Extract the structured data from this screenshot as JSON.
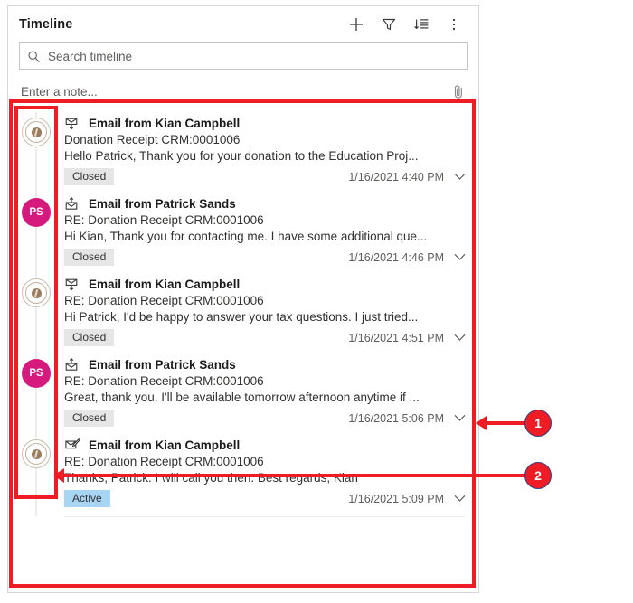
{
  "header": {
    "title": "Timeline",
    "tools": [
      {
        "name": "add-button",
        "icon": "plus-icon",
        "label": "Add"
      },
      {
        "name": "filter-button",
        "icon": "filter-icon",
        "label": "Filter"
      },
      {
        "name": "sort-button",
        "icon": "sort-descending-icon",
        "label": "Sort"
      },
      {
        "name": "more-commands-button",
        "icon": "more-vertical-icon",
        "label": "More commands"
      }
    ]
  },
  "search": {
    "placeholder": "Search timeline",
    "value": "",
    "icon": "search-icon"
  },
  "note": {
    "placeholder": "Enter a note...",
    "value": "",
    "attach_icon": "paperclip-icon"
  },
  "timeline": {
    "entries": [
      {
        "avatar_type": "logo",
        "avatar_initials": "",
        "icon": "email-outgoing-icon",
        "title": "Email from Kian Campbell",
        "subject": "Donation Receipt CRM:0001006",
        "snippet": "Hello Patrick,   Thank you for your donation to the Education Proj...",
        "badge": "Closed",
        "badge_state": "closed",
        "timestamp": "1/16/2021 4:40 PM",
        "chevron": "chevron-down-icon"
      },
      {
        "avatar_type": "initials",
        "avatar_initials": "PS",
        "icon": "email-incoming-icon",
        "title": "Email from Patrick Sands",
        "subject": "RE: Donation Receipt CRM:0001006",
        "snippet": "Hi Kian, Thank you for contacting me. I have some additional que...",
        "badge": "Closed",
        "badge_state": "closed",
        "timestamp": "1/16/2021 4:46 PM",
        "chevron": "chevron-down-icon"
      },
      {
        "avatar_type": "logo",
        "avatar_initials": "",
        "icon": "email-outgoing-icon",
        "title": "Email from Kian Campbell",
        "subject": "RE: Donation Receipt CRM:0001006",
        "snippet": "Hi Patrick,   I'd be happy to answer your tax questions. I just tried...",
        "badge": "Closed",
        "badge_state": "closed",
        "timestamp": "1/16/2021 4:51 PM",
        "chevron": "chevron-down-icon"
      },
      {
        "avatar_type": "initials",
        "avatar_initials": "PS",
        "icon": "email-incoming-icon",
        "title": "Email from Patrick Sands",
        "subject": "RE: Donation Receipt CRM:0001006",
        "snippet": "Great, thank you. I'll be available tomorrow afternoon anytime if ...",
        "badge": "Closed",
        "badge_state": "closed",
        "timestamp": "1/16/2021 5:06 PM",
        "chevron": "chevron-down-icon"
      },
      {
        "avatar_type": "logo",
        "avatar_initials": "",
        "icon": "email-draft-icon",
        "title": "Email from Kian Campbell",
        "subject": "RE: Donation Receipt CRM:0001006",
        "snippet": "Thanks, Patrick. I will call you then.   Best regards, Kian",
        "badge": "Active",
        "badge_state": "active",
        "timestamp": "1/16/2021 5:09 PM",
        "chevron": "chevron-down-icon"
      }
    ]
  },
  "annotations": {
    "callouts": [
      {
        "number": "1",
        "target": "timeline-records-region"
      },
      {
        "number": "2",
        "target": "timeline-avatar-rail"
      }
    ]
  },
  "colors": {
    "accent_pink": "#D6197D",
    "annotation_red": "#EE1C24",
    "annotation_border": "#2F3D87",
    "badge_closed": "#E6E6E6",
    "badge_active": "#A9D5F5"
  }
}
